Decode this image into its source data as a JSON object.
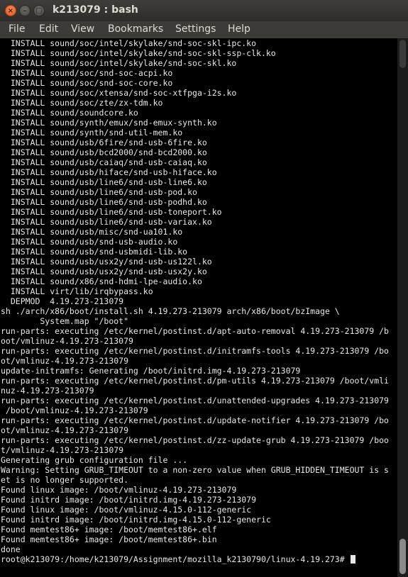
{
  "window": {
    "title": "k213079 : bash",
    "close_symbol": "×",
    "minimize_symbol": "–",
    "maximize_symbol": "□"
  },
  "menu": {
    "items": [
      {
        "label": "File"
      },
      {
        "label": "Edit"
      },
      {
        "label": "View"
      },
      {
        "label": "Bookmarks"
      },
      {
        "label": "Settings"
      },
      {
        "label": "Help"
      }
    ]
  },
  "terminal": {
    "lines": [
      "  INSTALL sound/soc/intel/skylake/snd-soc-skl-ipc.ko",
      "  INSTALL sound/soc/intel/skylake/snd-soc-skl-ssp-clk.ko",
      "  INSTALL sound/soc/intel/skylake/snd-soc-skl.ko",
      "  INSTALL sound/soc/snd-soc-acpi.ko",
      "  INSTALL sound/soc/snd-soc-core.ko",
      "  INSTALL sound/soc/xtensa/snd-soc-xtfpga-i2s.ko",
      "  INSTALL sound/soc/zte/zx-tdm.ko",
      "  INSTALL sound/soundcore.ko",
      "  INSTALL sound/synth/emux/snd-emux-synth.ko",
      "  INSTALL sound/synth/snd-util-mem.ko",
      "  INSTALL sound/usb/6fire/snd-usb-6fire.ko",
      "  INSTALL sound/usb/bcd2000/snd-bcd2000.ko",
      "  INSTALL sound/usb/caiaq/snd-usb-caiaq.ko",
      "  INSTALL sound/usb/hiface/snd-usb-hiface.ko",
      "  INSTALL sound/usb/line6/snd-usb-line6.ko",
      "  INSTALL sound/usb/line6/snd-usb-pod.ko",
      "  INSTALL sound/usb/line6/snd-usb-podhd.ko",
      "  INSTALL sound/usb/line6/snd-usb-toneport.ko",
      "  INSTALL sound/usb/line6/snd-usb-variax.ko",
      "  INSTALL sound/usb/misc/snd-ua101.ko",
      "  INSTALL sound/usb/snd-usb-audio.ko",
      "  INSTALL sound/usb/snd-usbmidi-lib.ko",
      "  INSTALL sound/usb/usx2y/snd-usb-us122l.ko",
      "  INSTALL sound/usb/usx2y/snd-usb-usx2y.ko",
      "  INSTALL sound/x86/snd-hdmi-lpe-audio.ko",
      "  INSTALL virt/lib/irqbypass.ko",
      "  DEPMOD  4.19.273-213079",
      "sh ./arch/x86/boot/install.sh 4.19.273-213079 arch/x86/boot/bzImage \\",
      "        System.map \"/boot\"",
      "run-parts: executing /etc/kernel/postinst.d/apt-auto-removal 4.19.273-213079 /b",
      "oot/vmlinuz-4.19.273-213079",
      "run-parts: executing /etc/kernel/postinst.d/initramfs-tools 4.19.273-213079 /bo",
      "ot/vmlinuz-4.19.273-213079",
      "update-initramfs: Generating /boot/initrd.img-4.19.273-213079",
      "run-parts: executing /etc/kernel/postinst.d/pm-utils 4.19.273-213079 /boot/vmli",
      "nuz-4.19.273-213079",
      "run-parts: executing /etc/kernel/postinst.d/unattended-upgrades 4.19.273-213079",
      " /boot/vmlinuz-4.19.273-213079",
      "run-parts: executing /etc/kernel/postinst.d/update-notifier 4.19.273-213079 /bo",
      "ot/vmlinuz-4.19.273-213079",
      "run-parts: executing /etc/kernel/postinst.d/zz-update-grub 4.19.273-213079 /boo",
      "t/vmlinuz-4.19.273-213079",
      "Generating grub configuration file ...",
      "Warning: Setting GRUB_TIMEOUT to a non-zero value when GRUB_HIDDEN_TIMEOUT is s",
      "et is no longer supported.",
      "Found linux image: /boot/vmlinuz-4.19.273-213079",
      "Found initrd image: /boot/initrd.img-4.19.273-213079",
      "Found linux image: /boot/vmlinuz-4.15.0-112-generic",
      "Found initrd image: /boot/initrd.img-4.15.0-112-generic",
      "Found memtest86+ image: /boot/memtest86+.elf",
      "Found memtest86+ image: /boot/memtest86+.bin",
      "done"
    ],
    "prompt": "root@k213079:/home/k213079/Assignment/mozilla_k2130790/linux-4.19.273# "
  }
}
